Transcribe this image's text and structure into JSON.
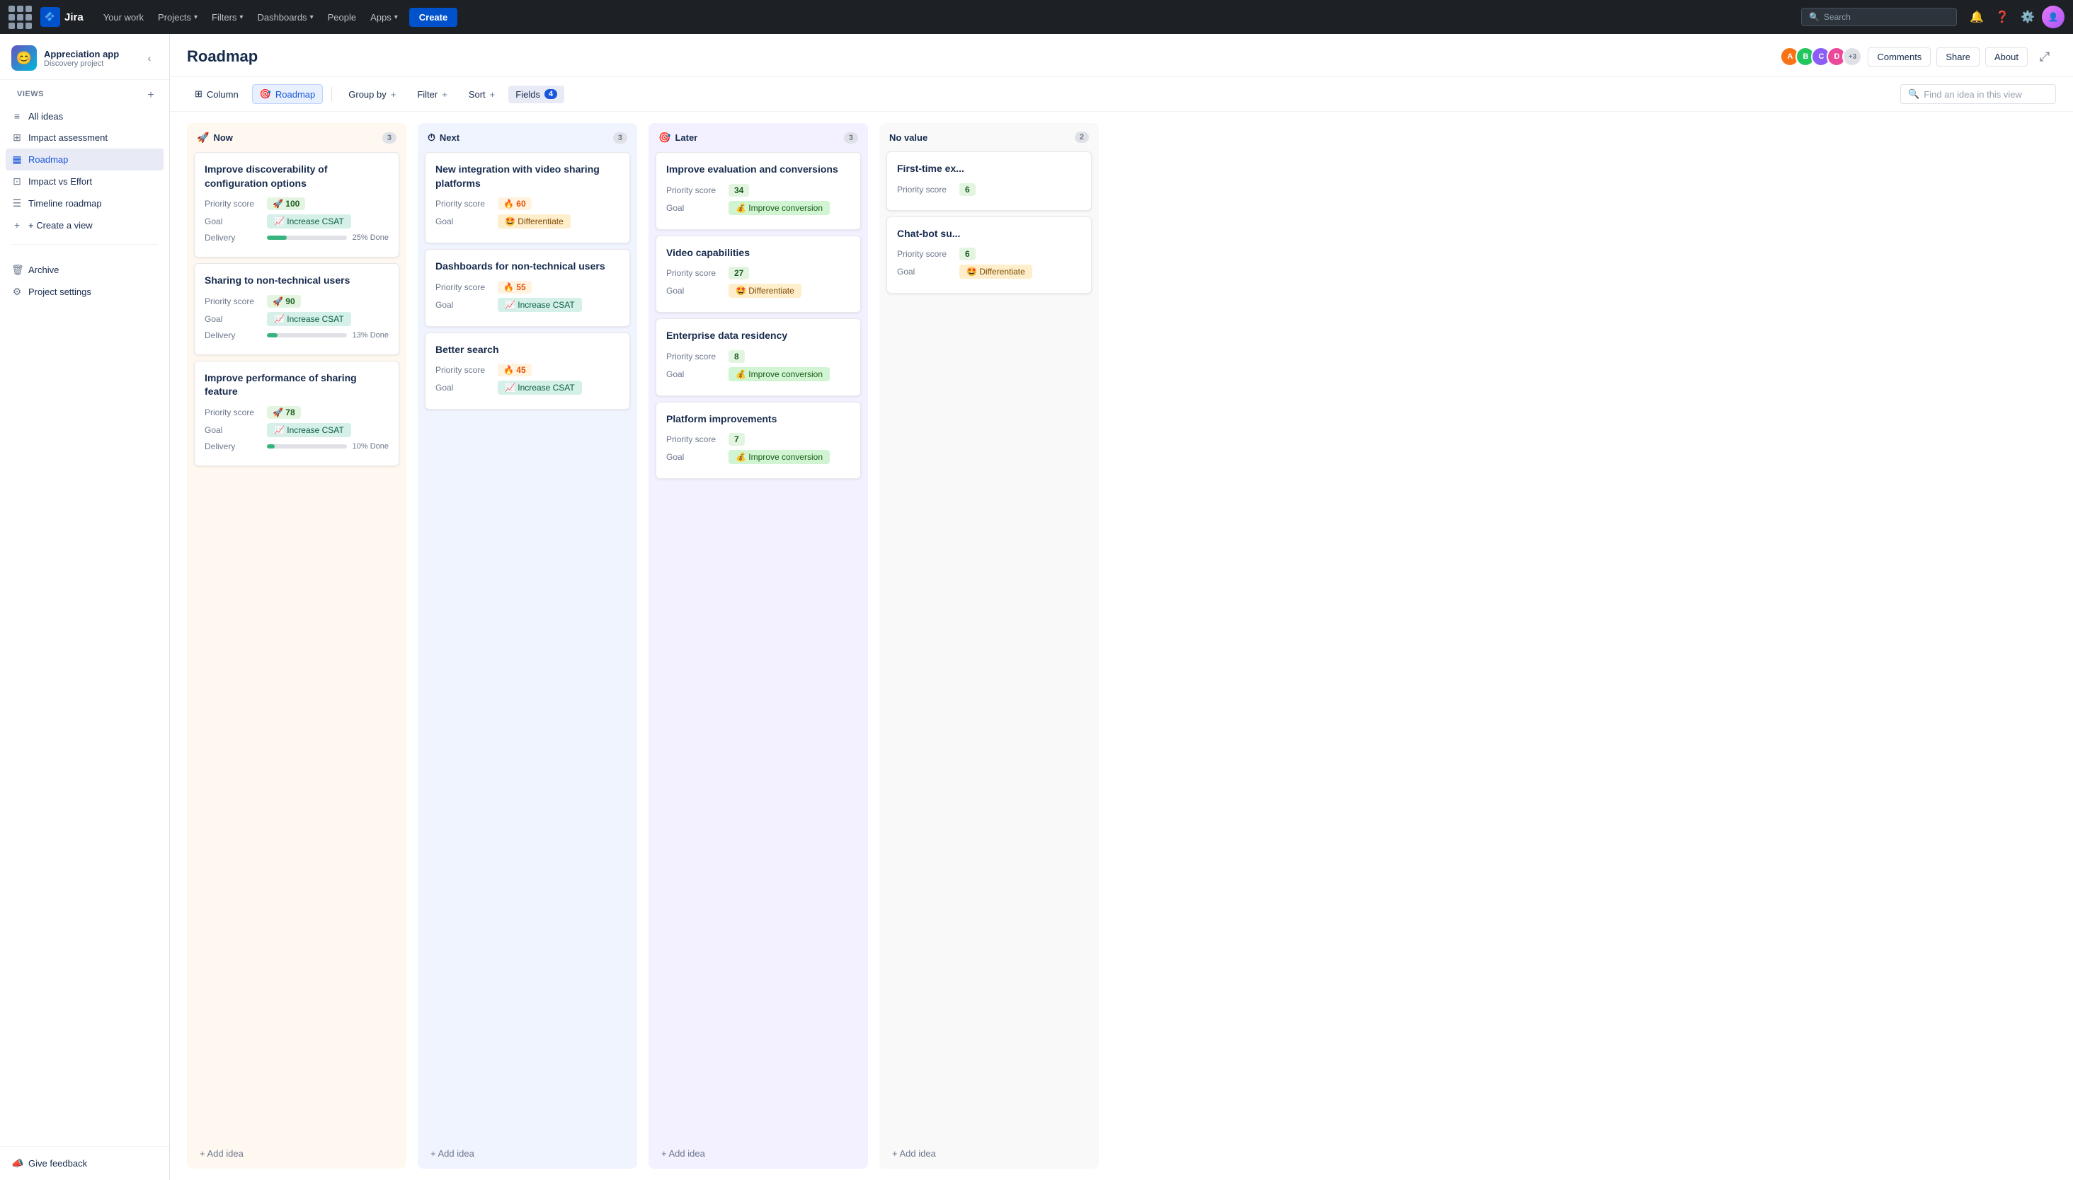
{
  "topnav": {
    "logo": "Jira",
    "your_work": "Your work",
    "projects": "Projects",
    "filters": "Filters",
    "dashboards": "Dashboards",
    "people": "People",
    "apps": "Apps",
    "create": "Create",
    "search_placeholder": "Search"
  },
  "sidebar": {
    "project_name": "Appreciation app",
    "project_type": "Discovery project",
    "views_label": "VIEWS",
    "views": [
      {
        "id": "all-ideas",
        "label": "All ideas",
        "icon": "≡"
      },
      {
        "id": "impact-assessment",
        "label": "Impact assessment",
        "icon": "⊞"
      },
      {
        "id": "roadmap",
        "label": "Roadmap",
        "icon": "▦",
        "active": true
      },
      {
        "id": "impact-vs-effort",
        "label": "Impact vs Effort",
        "icon": "⊡"
      },
      {
        "id": "timeline-roadmap",
        "label": "Timeline roadmap",
        "icon": "☰"
      }
    ],
    "create_view": "+ Create a view",
    "archive": "Archive",
    "project_settings": "Project settings",
    "give_feedback": "Give feedback"
  },
  "page": {
    "title": "Roadmap",
    "avatars": [
      "A",
      "B",
      "C",
      "D"
    ],
    "extra_count": "+3",
    "comments_btn": "Comments",
    "share_btn": "Share",
    "about_btn": "About"
  },
  "toolbar": {
    "column_btn": "Column",
    "roadmap_btn": "Roadmap",
    "group_by_btn": "Group by",
    "filter_btn": "Filter",
    "sort_btn": "Sort",
    "fields_btn": "Fields",
    "fields_count": "4",
    "search_placeholder": "Find an idea in this view"
  },
  "columns": [
    {
      "id": "now",
      "label": "Now",
      "emoji": "🚀",
      "type": "now",
      "count": 3,
      "add_btn": "+ Add idea",
      "cards": [
        {
          "id": "card-1",
          "title": "Improve discoverability of configuration options",
          "priority_score_label": "Priority score",
          "priority_score": "100",
          "score_type": "rocket",
          "score_emoji": "🚀",
          "goal_label": "Goal",
          "goal_text": "Increase CSAT",
          "goal_type": "increase-csat",
          "goal_emoji": "📈",
          "delivery_label": "Delivery",
          "progress": 25,
          "progress_text": "25% Done"
        },
        {
          "id": "card-2",
          "title": "Sharing to non-technical users",
          "priority_score_label": "Priority score",
          "priority_score": "90",
          "score_type": "rocket",
          "score_emoji": "🚀",
          "goal_label": "Goal",
          "goal_text": "Increase CSAT",
          "goal_type": "increase-csat",
          "goal_emoji": "📈",
          "delivery_label": "Delivery",
          "progress": 13,
          "progress_text": "13% Done"
        },
        {
          "id": "card-3",
          "title": "Improve performance of sharing feature",
          "priority_score_label": "Priority score",
          "priority_score": "78",
          "score_type": "rocket",
          "score_emoji": "🚀",
          "goal_label": "Goal",
          "goal_text": "Increase CSAT",
          "goal_type": "increase-csat",
          "goal_emoji": "📈",
          "delivery_label": "Delivery",
          "progress": 10,
          "progress_text": "10% Done"
        }
      ]
    },
    {
      "id": "next",
      "label": "Next",
      "emoji": "⏱",
      "type": "next",
      "count": 3,
      "add_btn": "+ Add idea",
      "cards": [
        {
          "id": "card-4",
          "title": "New integration with video sharing platforms",
          "priority_score_label": "Priority score",
          "priority_score": "60",
          "score_type": "fire",
          "score_emoji": "🔥",
          "goal_label": "Goal",
          "goal_text": "Differentiate",
          "goal_type": "differentiate",
          "goal_emoji": "🤩"
        },
        {
          "id": "card-5",
          "title": "Dashboards for non-technical users",
          "priority_score_label": "Priority score",
          "priority_score": "55",
          "score_type": "fire",
          "score_emoji": "🔥",
          "goal_label": "Goal",
          "goal_text": "Increase CSAT",
          "goal_type": "increase-csat",
          "goal_emoji": "📈"
        },
        {
          "id": "card-6",
          "title": "Better search",
          "priority_score_label": "Priority score",
          "priority_score": "45",
          "score_type": "fire",
          "score_emoji": "🔥",
          "goal_label": "Goal",
          "goal_text": "Increase CSAT",
          "goal_type": "increase-csat",
          "goal_emoji": "📈"
        }
      ]
    },
    {
      "id": "later",
      "label": "Later",
      "emoji": "🎯",
      "type": "later",
      "count": 3,
      "add_btn": "+ Add idea",
      "cards": [
        {
          "id": "card-7",
          "title": "Improve evaluation and conversions",
          "priority_score_label": "Priority score",
          "priority_score": "34",
          "score_type": "plain",
          "goal_label": "Goal",
          "goal_text": "Improve conversion",
          "goal_type": "improve-conversion",
          "goal_emoji": "💰"
        },
        {
          "id": "card-8",
          "title": "Video capabilities",
          "priority_score_label": "Priority score",
          "priority_score": "27",
          "score_type": "plain",
          "goal_label": "Goal",
          "goal_text": "Differentiate",
          "goal_type": "differentiate",
          "goal_emoji": "🤩"
        },
        {
          "id": "card-9",
          "title": "Enterprise data residency",
          "priority_score_label": "Priority score",
          "priority_score": "8",
          "score_type": "plain",
          "goal_label": "Goal",
          "goal_text": "Improve conversion",
          "goal_type": "improve-conversion",
          "goal_emoji": "💰"
        },
        {
          "id": "card-10",
          "title": "Platform improvements",
          "priority_score_label": "Priority score",
          "priority_score": "7",
          "score_type": "plain",
          "goal_label": "Goal",
          "goal_text": "Improve conversion",
          "goal_type": "improve-conversion",
          "goal_emoji": "💰"
        }
      ]
    },
    {
      "id": "no-value",
      "label": "No value",
      "type": "no-value",
      "count": 2,
      "add_btn": "+ Add idea",
      "cards": [
        {
          "id": "card-11",
          "title": "First-time ex...",
          "priority_score_label": "Priority score",
          "priority_score": "6",
          "score_type": "plain"
        },
        {
          "id": "card-12",
          "title": "Chat-bot su...",
          "priority_score_label": "Priority score",
          "priority_score": "6",
          "score_type": "plain",
          "goal_label": "Goal",
          "goal_text": "Differentiate",
          "goal_type": "differentiate",
          "goal_emoji": "🤩"
        }
      ]
    }
  ],
  "colors": {
    "now_bg": "#fff8f0",
    "next_bg": "#f0f4ff",
    "later_bg": "#f3f0ff",
    "no_value_bg": "#f9f9f9",
    "accent": "#0052cc"
  }
}
